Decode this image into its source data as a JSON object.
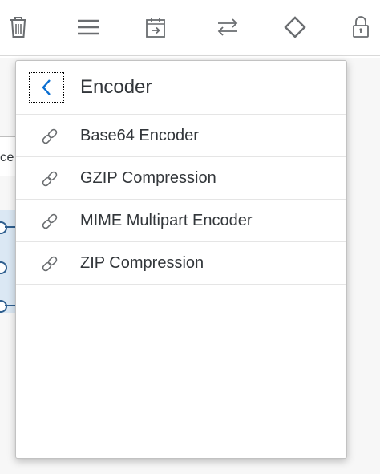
{
  "toolbar": {
    "icons": [
      "trash-icon",
      "menu-icon",
      "calendar-import-icon",
      "swap-arrows-icon",
      "diamond-icon",
      "lock-icon"
    ]
  },
  "background": {
    "partial_label": "ce"
  },
  "popover": {
    "title": "Encoder",
    "items": [
      {
        "label": "Base64 Encoder",
        "icon": "link-icon"
      },
      {
        "label": "GZIP Compression",
        "icon": "link-icon"
      },
      {
        "label": "MIME Multipart Encoder",
        "icon": "link-icon"
      },
      {
        "label": "ZIP Compression",
        "icon": "link-icon"
      }
    ]
  },
  "colors": {
    "icon_gray": "#6a6d70",
    "accent_blue": "#0a6ed1",
    "text": "#32363a"
  }
}
